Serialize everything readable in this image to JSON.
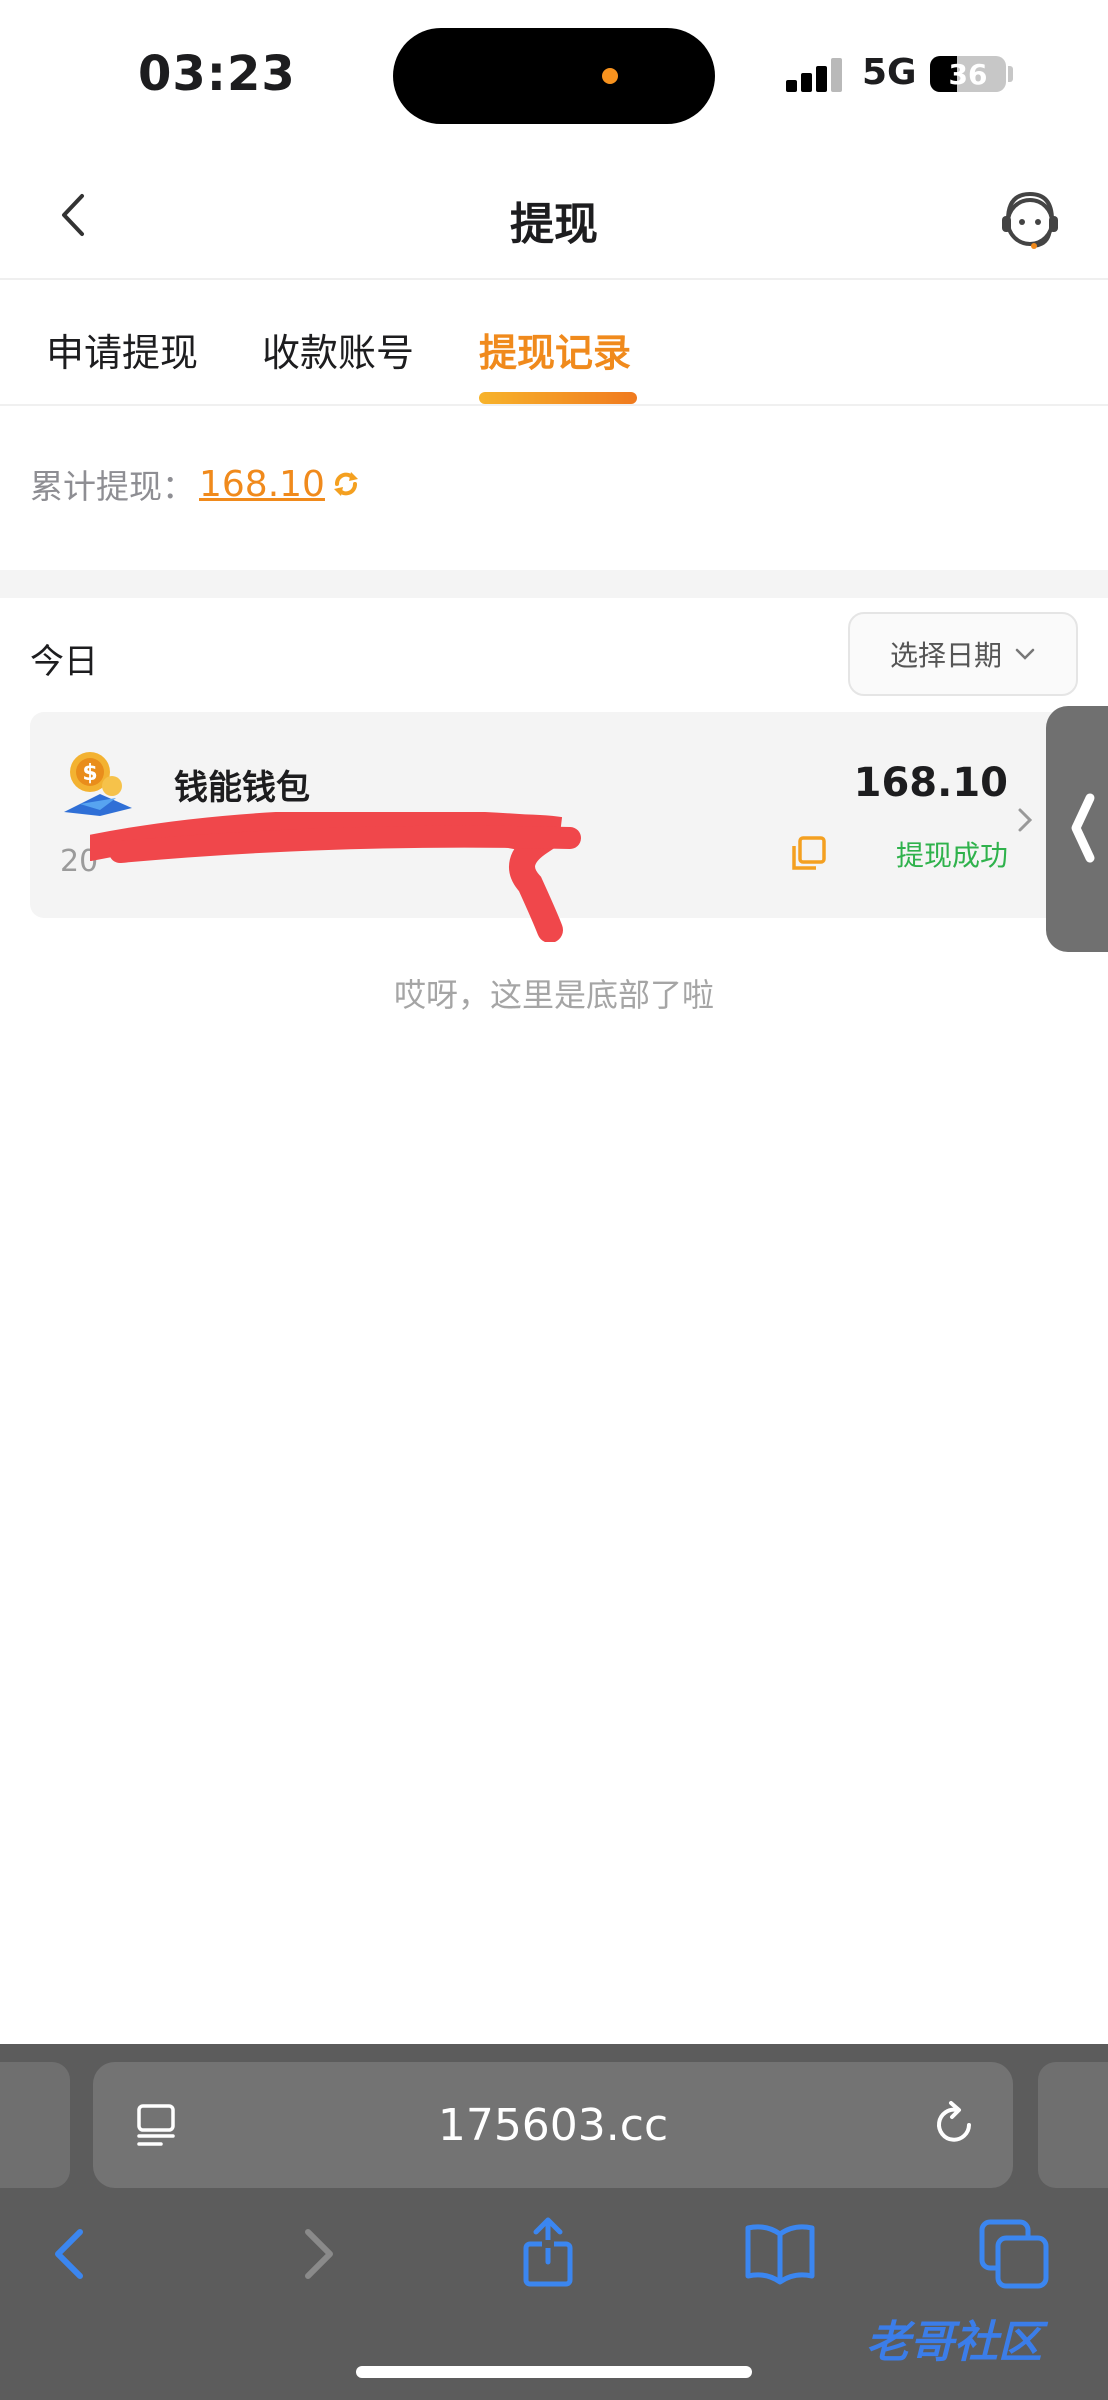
{
  "status_bar": {
    "time": "03:23",
    "network": "5G",
    "battery": "36",
    "battery_level": 0.36
  },
  "header": {
    "title": "提现"
  },
  "tabs": [
    {
      "label": "申请提现",
      "active": false
    },
    {
      "label": "收款账号",
      "active": false
    },
    {
      "label": "提现记录",
      "active": true
    }
  ],
  "summary": {
    "label": "累计提现：",
    "value": "168.10"
  },
  "filter": {
    "day_label": "今日",
    "date_picker_label": "选择日期"
  },
  "records": [
    {
      "wallet": "钱能钱包",
      "time": "20",
      "amount": "168.10",
      "status": "提现成功"
    }
  ],
  "footer_note": "哎呀，这里是底部了啦",
  "browser": {
    "url": "175603.cc"
  },
  "watermark": "老哥社区",
  "colors": {
    "accent": "#f08a1c",
    "success": "#2fb24c",
    "link_blue": "#3b7de9"
  }
}
